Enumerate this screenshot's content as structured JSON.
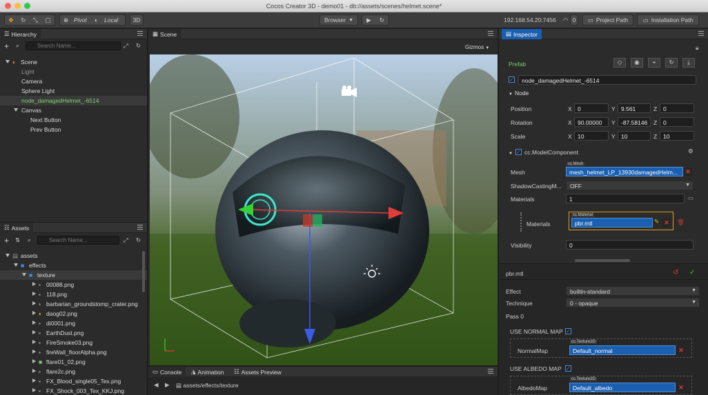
{
  "app": {
    "title": "Cocos Creator 3D - demo01 - db://assets/scenes/helmet.scene*"
  },
  "toolbar": {
    "pivot_label": "Pivot",
    "local_label": "Local",
    "mode_3d": "3D",
    "browser_label": "Browser",
    "ip": "192.168.54.20:7456",
    "count": "0",
    "project_path": "Project Path",
    "install_path": "Installation Path"
  },
  "hierarchy": {
    "tab": "Hierarchy",
    "search_placeholder": "Search Name...",
    "items": [
      {
        "label": "Scene"
      },
      {
        "label": "Light"
      },
      {
        "label": "Camera"
      },
      {
        "label": "Sphere Light"
      },
      {
        "label": "node_damagedHelmet_-6514"
      },
      {
        "label": "Canvas"
      },
      {
        "label": "Next Button"
      },
      {
        "label": "Prev Button"
      }
    ]
  },
  "assets": {
    "tab": "Assets",
    "search_placeholder": "Search Name...",
    "items": [
      {
        "label": "assets"
      },
      {
        "label": "effects"
      },
      {
        "label": "texture"
      },
      {
        "label": "00088.png"
      },
      {
        "label": "118.png"
      },
      {
        "label": "barbarian_groundstomp_crater.png"
      },
      {
        "label": "daog02.png"
      },
      {
        "label": "di0001.png"
      },
      {
        "label": "EarthDust.png"
      },
      {
        "label": "FireSmoke03.png"
      },
      {
        "label": "fireWall_floorAlpha.png"
      },
      {
        "label": "flare01_02.png"
      },
      {
        "label": "flare2c.png"
      },
      {
        "label": "FX_Blood_single05_Tex.png"
      },
      {
        "label": "FX_Shock_003_Tex_KKJ.png"
      }
    ]
  },
  "scene": {
    "tab": "Scene",
    "gizmos": "Gizmos"
  },
  "bottom": {
    "tabs": [
      {
        "label": "Console"
      },
      {
        "label": "Animation"
      },
      {
        "label": "Assets Preview"
      }
    ],
    "path": [
      "assets",
      "effects",
      "texture"
    ],
    "sep": "/"
  },
  "inspector": {
    "tab": "Inspector",
    "prefab": "Prefab",
    "node_name": "node_damagedHelmet_-6514",
    "node_section": "Node",
    "axes": {
      "x": "X",
      "y": "Y",
      "z": "Z"
    },
    "position": {
      "label": "Position",
      "x": "0",
      "y": "9.561",
      "z": "0"
    },
    "rotation": {
      "label": "Rotation",
      "x": "90.00000",
      "y": "-87.58146",
      "z": "0"
    },
    "scale": {
      "label": "Scale",
      "x": "10",
      "y": "10",
      "z": "10"
    },
    "component": "cc.ModelComponent",
    "mesh": {
      "label": "Mesh",
      "type": "cc.Mesh",
      "value": "mesh_helmet_LP_13930damagedHelm..."
    },
    "shadow": {
      "label": "ShadowCastingM...",
      "value": "OFF"
    },
    "materials": {
      "label": "Materials",
      "count": "1"
    },
    "material": {
      "label": "Materials",
      "type": "cc.Material",
      "value": "pbr.mtl"
    },
    "visibility": {
      "label": "Visibility",
      "value": "0"
    },
    "mtl": {
      "title": "pbr.mtl",
      "effect_label": "Effect",
      "effect_value": "builtin-standard",
      "technique_label": "Technique",
      "technique_value": "0 - opaque",
      "pass": "Pass 0",
      "use_normal": "USE NORMAL MAP",
      "normal_label": "NormalMap",
      "normal_type": "cc.Texture2D",
      "normal_value": "Default_normal",
      "use_albedo": "USE ALBEDO MAP",
      "albedo_label": "AlbedoMap",
      "albedo_type": "cc.Texture2D",
      "albedo_value": "Default_albedo"
    }
  },
  "colors": {
    "accent": "#3a7bd5",
    "prefab_green": "#7ed36f",
    "danger": "#e03a3a"
  }
}
